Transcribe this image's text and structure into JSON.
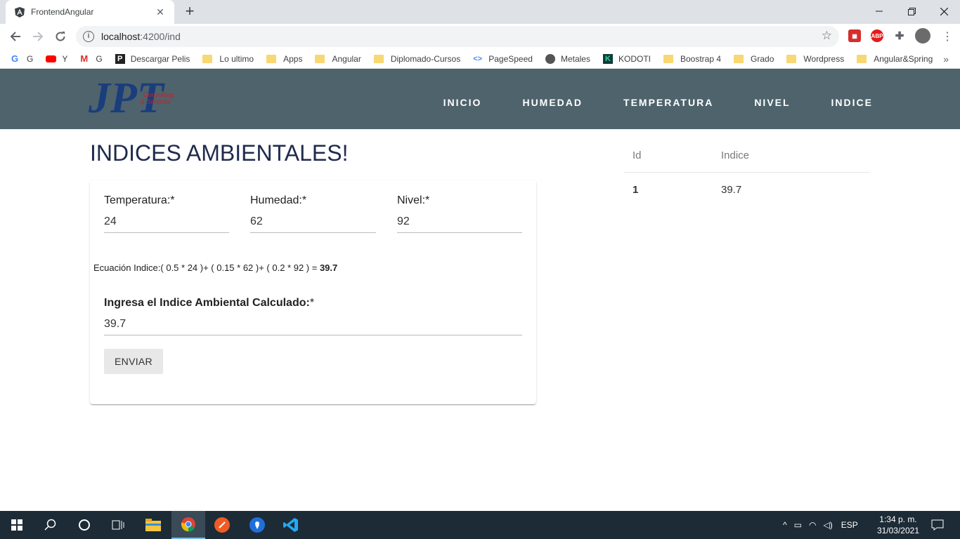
{
  "browser": {
    "tab_title": "FrontendAngular",
    "url_host": "localhost",
    "url_rest": ":4200/ind",
    "bookmarks": [
      {
        "label": "G",
        "icon": "google-icon"
      },
      {
        "label": "Y",
        "icon": "youtube-icon"
      },
      {
        "label": "G",
        "icon": "gmail-icon"
      },
      {
        "label": "Descargar Pelis",
        "icon": "p-icon"
      },
      {
        "label": "Lo ultimo",
        "icon": "folder-icon"
      },
      {
        "label": "Apps",
        "icon": "folder-icon"
      },
      {
        "label": "Angular",
        "icon": "folder-icon"
      },
      {
        "label": "Diplomado-Cursos",
        "icon": "folder-icon"
      },
      {
        "label": "PageSpeed",
        "icon": "pagespeed-icon"
      },
      {
        "label": "Metales",
        "icon": "globe-icon"
      },
      {
        "label": "KODOTI",
        "icon": "kodoti-icon"
      },
      {
        "label": "Boostrap 4",
        "icon": "folder-icon"
      },
      {
        "label": "Grado",
        "icon": "folder-icon"
      },
      {
        "label": "Wordpress",
        "icon": "folder-icon"
      },
      {
        "label": "Angular&Spring",
        "icon": "folder-icon"
      }
    ],
    "bookmarks_more": "»"
  },
  "app": {
    "logo_text": "JPT",
    "logo_sub1": "Consulting",
    "logo_sub2": "& Services",
    "nav": [
      "INICIO",
      "HUMEDAD",
      "TEMPERATURA",
      "NIVEL",
      "INDICE"
    ],
    "page_title": "INDICES AMBIENTALES!",
    "form": {
      "temperatura_label": "Temperatura:*",
      "temperatura_value": "24",
      "humedad_label": "Humedad:*",
      "humedad_value": "62",
      "nivel_label": "Nivel:*",
      "nivel_value": "92",
      "equation_text": "Ecuación Indice:( 0.5 * 24 )+ ( 0.15 * 62 )+ ( 0.2 * 92 ) = ",
      "equation_result": "39.7",
      "indice_label": "Ingresa el Indice Ambiental Calculado:",
      "indice_required": "*",
      "indice_value": "39.7",
      "submit_label": "ENVIAR"
    },
    "table": {
      "headers": [
        "Id",
        "Indice"
      ],
      "rows": [
        {
          "id": "1",
          "indice": "39.7"
        }
      ]
    }
  },
  "taskbar": {
    "lang": "ESP",
    "time": "1:34 p. m.",
    "date": "31/03/2021"
  },
  "colors": {
    "appbar": "#4e636c",
    "title": "#1f2a4d",
    "taskbar": "#1c2b36"
  }
}
